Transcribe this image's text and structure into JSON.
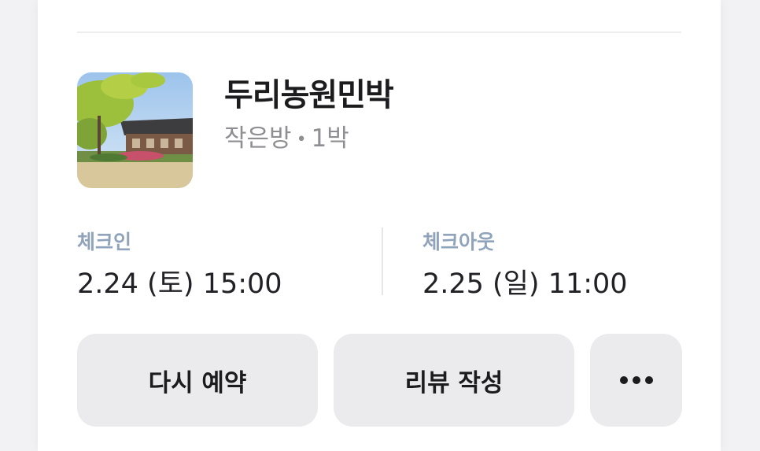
{
  "listing": {
    "name": "두리농원민박",
    "room": "작은방",
    "separator": "•",
    "nights": "1박",
    "thumbnail_icon": "guesthouse-photo"
  },
  "checkin": {
    "label": "체크인",
    "value": "2.24 (토) 15:00"
  },
  "checkout": {
    "label": "체크아웃",
    "value": "2.25 (일) 11:00"
  },
  "actions": {
    "rebook_label": "다시 예약",
    "review_label": "리뷰 작성",
    "more_icon": "more-horizontal-icon"
  },
  "colors": {
    "label_accent": "#8fa3bb",
    "button_bg": "#ebebed",
    "subtitle": "#8e8e93"
  }
}
